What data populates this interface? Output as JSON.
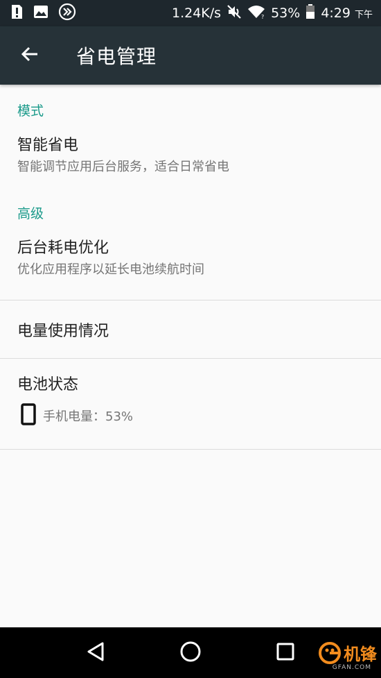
{
  "status_bar": {
    "network_speed": "1.24K/s",
    "battery_percent": "53%",
    "time": "4:29",
    "ampm": "下午",
    "icons": [
      "alert-icon",
      "image-icon",
      "fast-forward-icon",
      "mute-icon",
      "wifi-icon",
      "battery-icon"
    ]
  },
  "app_bar": {
    "title": "省电管理"
  },
  "sections": {
    "mode": {
      "header": "模式",
      "smart_saving": {
        "title": "智能省电",
        "subtitle": "智能调节应用后台服务，适合日常省电"
      }
    },
    "advanced": {
      "header": "高级",
      "background_optimization": {
        "title": "后台耗电优化",
        "subtitle": "优化应用程序以延长电池续航时间"
      }
    },
    "usage": {
      "title": "电量使用情况"
    },
    "battery_status": {
      "title": "电池状态",
      "phone_battery": "手机电量：53%"
    }
  },
  "watermark": {
    "brand": "机锋",
    "domain": "GFAN.COM"
  },
  "colors": {
    "status_bar": "#1e272d",
    "app_bar": "#263238",
    "accent": "#1a9a8a",
    "background": "#fafafa",
    "watermark": "#f28c1e"
  }
}
